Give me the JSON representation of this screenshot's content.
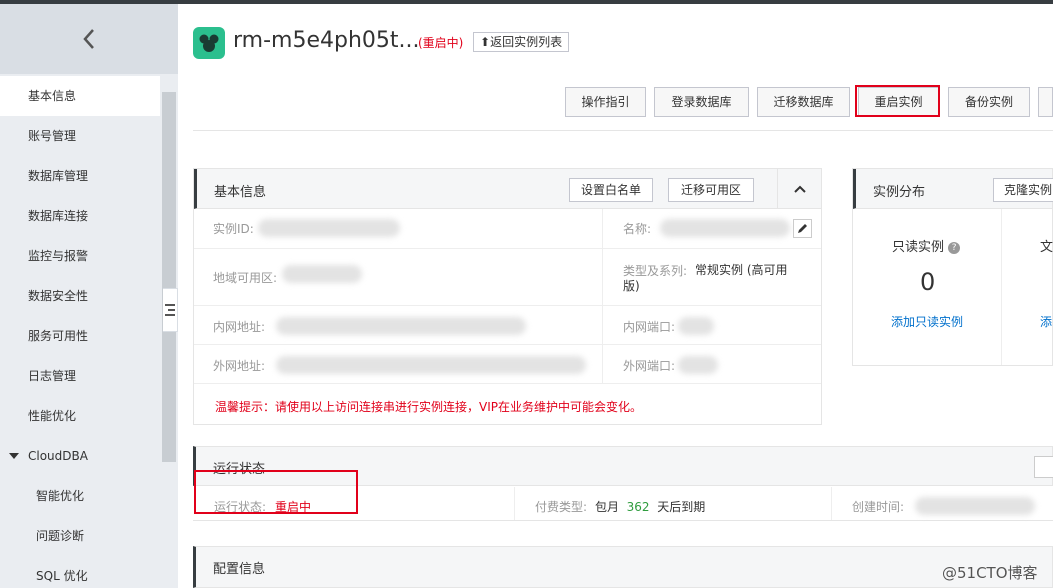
{
  "header": {
    "instance_name": "rm-m5e4ph05t...",
    "status": "(重启中)",
    "back_label": "返回实例列表"
  },
  "sidebar": {
    "items": [
      {
        "label": "基本信息"
      },
      {
        "label": "账号管理"
      },
      {
        "label": "数据库管理"
      },
      {
        "label": "数据库连接"
      },
      {
        "label": "监控与报警"
      },
      {
        "label": "数据安全性"
      },
      {
        "label": "服务可用性"
      },
      {
        "label": "日志管理"
      },
      {
        "label": "性能优化"
      },
      {
        "label": "CloudDBA"
      },
      {
        "label": "智能优化"
      },
      {
        "label": "问题诊断"
      },
      {
        "label": "SQL 优化"
      }
    ]
  },
  "toolbar": {
    "guide": "操作指引",
    "login_db": "登录数据库",
    "migrate_db": "迁移数据库",
    "restart": "重启实例",
    "backup": "备份实例"
  },
  "basic_info": {
    "title": "基本信息",
    "whitelist_btn": "设置白名单",
    "migrate_zone_btn": "迁移可用区",
    "instance_id_label": "实例ID:",
    "name_label": "名称:",
    "region_label": "地域可用区:",
    "type_label": "类型及系列:",
    "type_value": "常规实例 (高可用版)",
    "intranet_addr_label": "内网地址:",
    "intranet_port_label": "内网端口:",
    "internet_addr_label": "外网地址:",
    "internet_port_label": "外网端口:",
    "warning": "温馨提示：请使用以上访问连接串进行实例连接，VIP在业务维护中可能会变化。"
  },
  "distribution": {
    "title": "实例分布",
    "clone_btn": "克隆实例",
    "readonly_label": "只读实例",
    "readonly_count": "0",
    "add_readonly_link": "添加只读实例"
  },
  "run_status": {
    "title": "运行状态",
    "status_label": "运行状态:",
    "status_value": "重启中",
    "pay_label": "付费类型:",
    "pay_value": "包月",
    "days_left": "362",
    "expire_suffix": "天后到期",
    "created_label": "创建时间:"
  },
  "config": {
    "title": "配置信息"
  },
  "watermark": "@51CTO博客",
  "colors": {
    "accent_red": "#e1001a",
    "link_blue": "#0070cc",
    "logo_green": "#2bbf8e"
  }
}
